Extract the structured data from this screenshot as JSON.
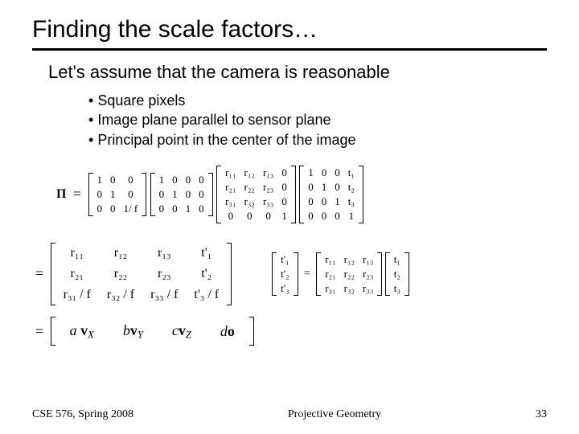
{
  "title": "Finding the scale factors…",
  "lead": "Let's assume that the camera is reasonable",
  "bullets": [
    "Square pixels",
    "Image plane parallel to sensor plane",
    "Principal point in the center of the image"
  ],
  "eq1": {
    "lhs": "Π",
    "A": [
      [
        "1",
        "0",
        "0"
      ],
      [
        "0",
        "1",
        "0"
      ],
      [
        "0",
        "0",
        "1/ f"
      ]
    ],
    "B": [
      [
        "1",
        "0",
        "0",
        "0"
      ],
      [
        "0",
        "1",
        "0",
        "0"
      ],
      [
        "0",
        "0",
        "1",
        "0"
      ]
    ],
    "C": [
      [
        "r₁₁",
        "r₁₂",
        "r₁₃",
        "0"
      ],
      [
        "r₂₁",
        "r₂₂",
        "r₂₃",
        "0"
      ],
      [
        "r₃₁",
        "r₃₂",
        "r₃₃",
        "0"
      ],
      [
        "0",
        "0",
        "0",
        "1"
      ]
    ],
    "D": [
      [
        "1",
        "0",
        "0",
        "t₁"
      ],
      [
        "0",
        "1",
        "0",
        "t₂"
      ],
      [
        "0",
        "0",
        "1",
        "t₃"
      ],
      [
        "0",
        "0",
        "0",
        "1"
      ]
    ]
  },
  "eq2": {
    "M": [
      [
        "r₁₁",
        "r₁₂",
        "r₁₃",
        "t'₁"
      ],
      [
        "r₂₁",
        "r₂₂",
        "r₂₃",
        "t'₂"
      ],
      [
        "r₃₁ / f",
        "r₃₂ / f",
        "r₃₃ / f",
        "t'₃ / f"
      ]
    ]
  },
  "eq2b": {
    "L": [
      [
        "t'₁"
      ],
      [
        "t'₂"
      ],
      [
        "t'₃"
      ]
    ],
    "R1": [
      [
        "r₁₁",
        "r₁₂",
        "r₁₃"
      ],
      [
        "r₂₁",
        "r₂₂",
        "r₂₃"
      ],
      [
        "r₃₁",
        "r₃₂",
        "r₃₃"
      ]
    ],
    "R2": [
      [
        "t₁"
      ],
      [
        "t₂"
      ],
      [
        "t₃"
      ]
    ]
  },
  "eq3": {
    "cells": [
      "a vₓ",
      "b v_Y",
      "c v_Z",
      "d o"
    ]
  },
  "footer": {
    "left": "CSE 576, Spring 2008",
    "center": "Projective Geometry",
    "right": "33"
  }
}
